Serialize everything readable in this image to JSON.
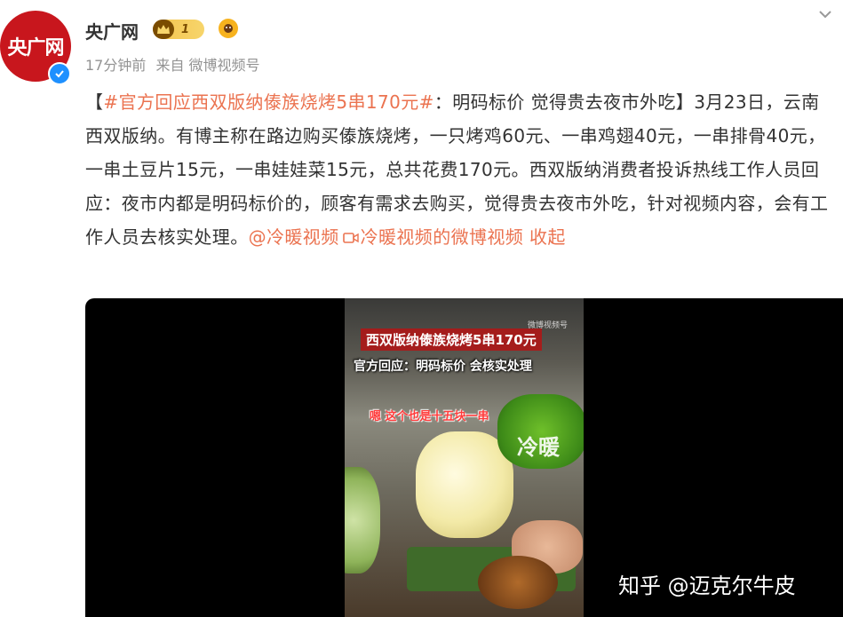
{
  "author": {
    "avatar_text": "央广网",
    "name": "央广网",
    "vip_level": "1",
    "meta_time": "17分钟前",
    "meta_source": "来自 微博视频号"
  },
  "post": {
    "bracket_open": "【",
    "hashtag": "#官方回应西双版纳傣族烧烤5串170元#",
    "headline_rest": "：明码标价 觉得贵去夜市外吃】",
    "body": "3月23日，云南西双版纳。有博主称在路边购买傣族烧烤，一只烤鸡60元、一串鸡翅40元，一串排骨40元，一串土豆片15元，一串娃娃菜15元，总共花费170元。西双版纳消费者投诉热线工作人员回应：夜市内都是明码标价的，顾客有需求去购买，觉得贵去夜市外吃，针对视频内容，会有工作人员去核实处理。",
    "mention": "@冷暖视频",
    "video_link": "冷暖视频的微博视频",
    "collapse": "收起"
  },
  "video": {
    "caption_title": "西双版纳傣族烧烤5串170元",
    "caption_response": "官方回应：明码标价 会核实处理",
    "caption_speech": "嗯 这个也是十五块一串",
    "watermark_small": "微博视频号",
    "watermark_channel": "冷暖"
  },
  "watermark": "知乎 @迈克尔牛皮",
  "colors": {
    "link": "#eb7350",
    "avatar_bg": "#c8161d",
    "verified": "#1e90ff"
  }
}
